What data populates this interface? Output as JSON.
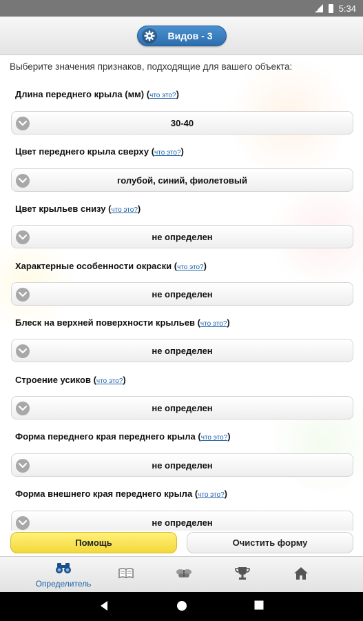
{
  "status_bar": {
    "time": "5:34"
  },
  "header": {
    "species_label": "Видов - 3"
  },
  "content": {
    "intro": "Выберите значения признаков, подходящие для вашего объекта:",
    "help_text": "что это?",
    "fields": [
      {
        "label": "Длина переднего крыла (мм)",
        "value": "30-40"
      },
      {
        "label": "Цвет переднего крыла сверху",
        "value": "голубой, синий, фиолетовый"
      },
      {
        "label": "Цвет крыльев снизу",
        "value": "не определен"
      },
      {
        "label": "Характерные особенности окраски",
        "value": "не определен"
      },
      {
        "label": "Блеск на верхней поверхности крыльев",
        "value": "не определен"
      },
      {
        "label": "Строение усиков",
        "value": "не определен"
      },
      {
        "label": "Форма переднего края переднего крыла",
        "value": "не определен"
      },
      {
        "label": "Форма внешнего края переднего крыла",
        "value": "не определен"
      }
    ]
  },
  "footer": {
    "help_button": "Помощь",
    "clear_button": "Очистить форму"
  },
  "bottom_nav": {
    "items": [
      {
        "label": "Определитель",
        "icon": "binoculars-icon",
        "active": true
      },
      {
        "label": "",
        "icon": "book-icon",
        "active": false
      },
      {
        "label": "",
        "icon": "butterfly-icon",
        "active": false
      },
      {
        "label": "",
        "icon": "trophy-icon",
        "active": false
      },
      {
        "label": "",
        "icon": "home-icon",
        "active": false
      }
    ]
  },
  "colors": {
    "accent_blue": "#2d6fae",
    "help_yellow": "#f3d83a",
    "link_blue": "#1a5fa8"
  }
}
